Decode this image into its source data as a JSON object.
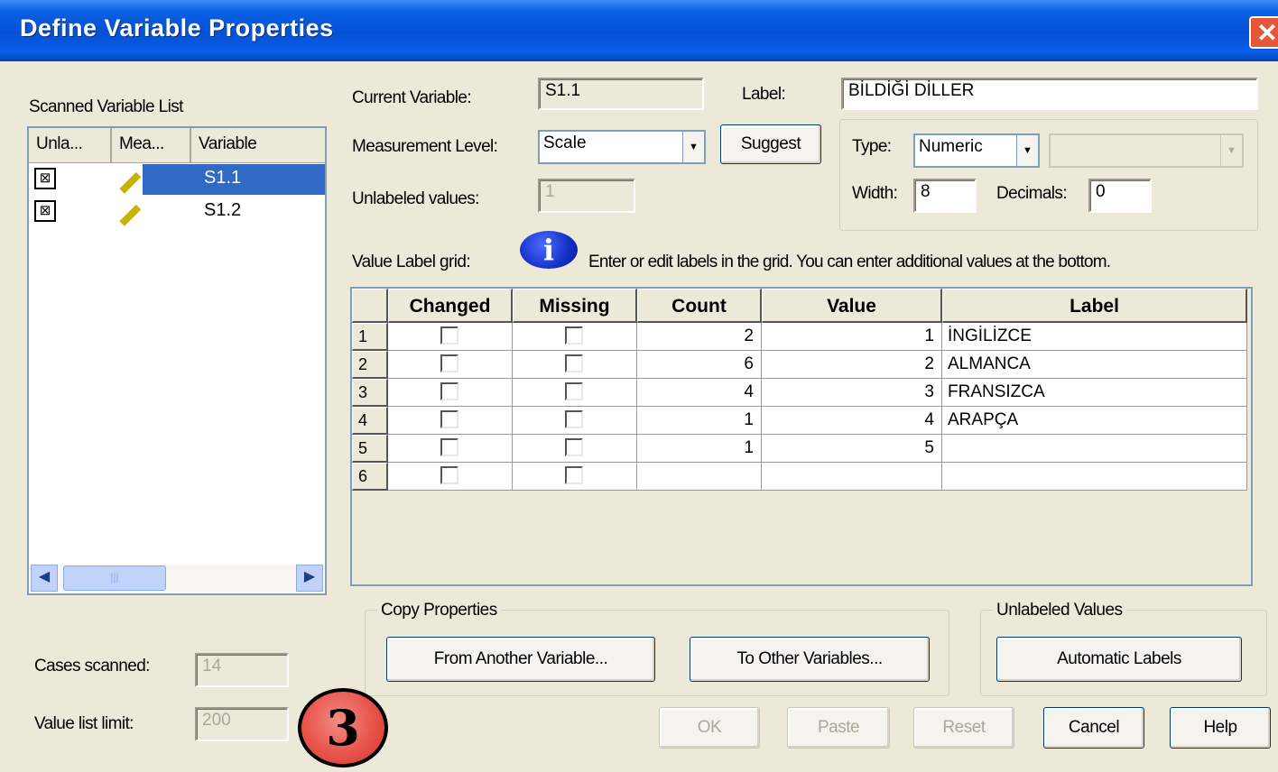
{
  "window": {
    "title": "Define Variable Properties",
    "close_glyph": "✕"
  },
  "scanned": {
    "title": "Scanned Variable List",
    "columns": [
      "Unla...",
      "Mea...",
      "Variable"
    ],
    "rows": [
      {
        "unlabeled_icon": "checkbox-x-icon",
        "measure_icon": "ruler-icon",
        "variable": "S1.1",
        "selected": true
      },
      {
        "unlabeled_icon": "checkbox-x-icon",
        "measure_icon": "ruler-icon",
        "variable": "S1.2",
        "selected": false
      }
    ]
  },
  "current": {
    "label": "Current Variable:",
    "value": "S1.1",
    "label_caption": "Label:",
    "label_value": "BİLDİĞİ DİLLER"
  },
  "measurement": {
    "label": "Measurement Level:",
    "value": "Scale",
    "suggest_label": "Suggest"
  },
  "unlabeled": {
    "label": "Unlabeled values:",
    "value": "1"
  },
  "type_box": {
    "type_label": "Type:",
    "type_value": "Numeric",
    "width_label": "Width:",
    "width_value": "8",
    "decimals_label": "Decimals:",
    "decimals_value": "0"
  },
  "value_grid": {
    "caption": "Value Label grid:",
    "info_text": "Enter or edit labels in the grid.  You can enter additional values at the bottom.",
    "info_icon": "i",
    "headers": [
      "Changed",
      "Missing",
      "Count",
      "Value",
      "Label"
    ],
    "rows": [
      {
        "n": "1",
        "count": "2",
        "value": "1",
        "label": "İNGİLİZCE"
      },
      {
        "n": "2",
        "count": "6",
        "value": "2",
        "label": "ALMANCA"
      },
      {
        "n": "3",
        "count": "4",
        "value": "3",
        "label": "FRANSIZCA"
      },
      {
        "n": "4",
        "count": "1",
        "value": "4",
        "label": "ARAPÇA"
      },
      {
        "n": "5",
        "count": "1",
        "value": "5",
        "label": ""
      },
      {
        "n": "6",
        "count": "",
        "value": "",
        "label": ""
      }
    ]
  },
  "copy": {
    "legend": "Copy Properties",
    "from_label": "From Another Variable...",
    "to_label": "To Other Variables..."
  },
  "unlabeled_values": {
    "legend": "Unlabeled Values",
    "auto_label": "Automatic Labels"
  },
  "stats": {
    "cases_label": "Cases scanned:",
    "cases_value": "14",
    "limit_label": "Value list limit:",
    "limit_value": "200"
  },
  "buttons": {
    "ok": "OK",
    "paste": "Paste",
    "reset": "Reset",
    "cancel": "Cancel",
    "help": "Help"
  },
  "annotation": {
    "step": "3"
  }
}
